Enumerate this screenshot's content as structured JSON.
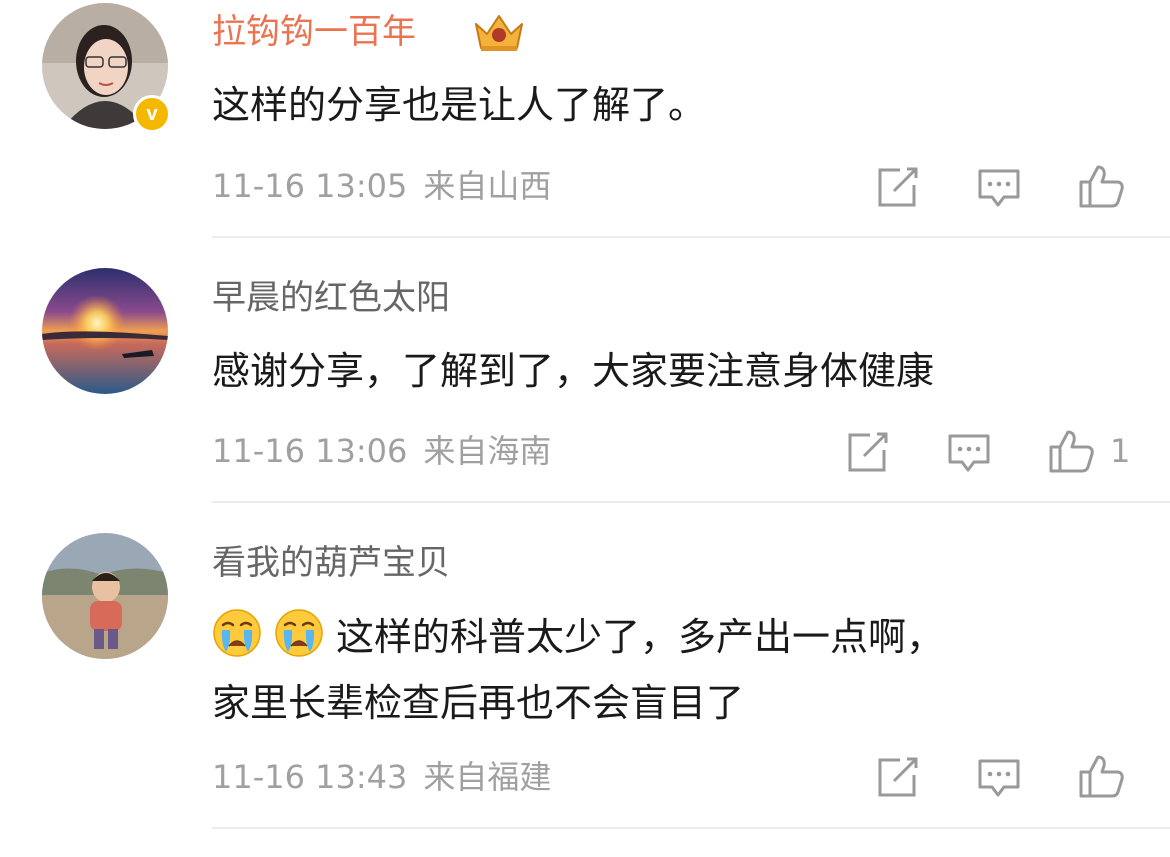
{
  "comments": [
    {
      "username": "拉钩钩一百年",
      "verified": true,
      "verified_badge": "v",
      "vip_crown": true,
      "text_lines": [
        "这样的分享也是让人了解了。"
      ],
      "emoji_prefix": [],
      "time": "11-16 13:05",
      "source": "来自山西",
      "likes": ""
    },
    {
      "username": "早晨的红色太阳",
      "verified": false,
      "vip_crown": false,
      "text_lines": [
        "感谢分享，了解到了，大家要注意身体健康"
      ],
      "emoji_prefix": [],
      "time": "11-16 13:06",
      "source": "来自海南",
      "likes": "1"
    },
    {
      "username": "看我的葫芦宝贝",
      "verified": false,
      "vip_crown": false,
      "text_lines": [
        "这样的科普太少了，多产出一点啊，",
        "家里长辈检查后再也不会盲目了"
      ],
      "emoji_prefix": [
        "crying-face",
        "crying-face"
      ],
      "time": "11-16 13:43",
      "source": "来自福建",
      "likes": ""
    }
  ],
  "icons": {
    "share": "share-edit-icon",
    "comment": "comment-bubble-icon",
    "like": "thumbs-up-icon"
  },
  "colors": {
    "vip_name": "#eb7350",
    "name": "#666666",
    "text": "#1a1a1a",
    "meta": "#a0a0a0",
    "verified_badge": "#f5b800",
    "divider": "#ececec"
  }
}
